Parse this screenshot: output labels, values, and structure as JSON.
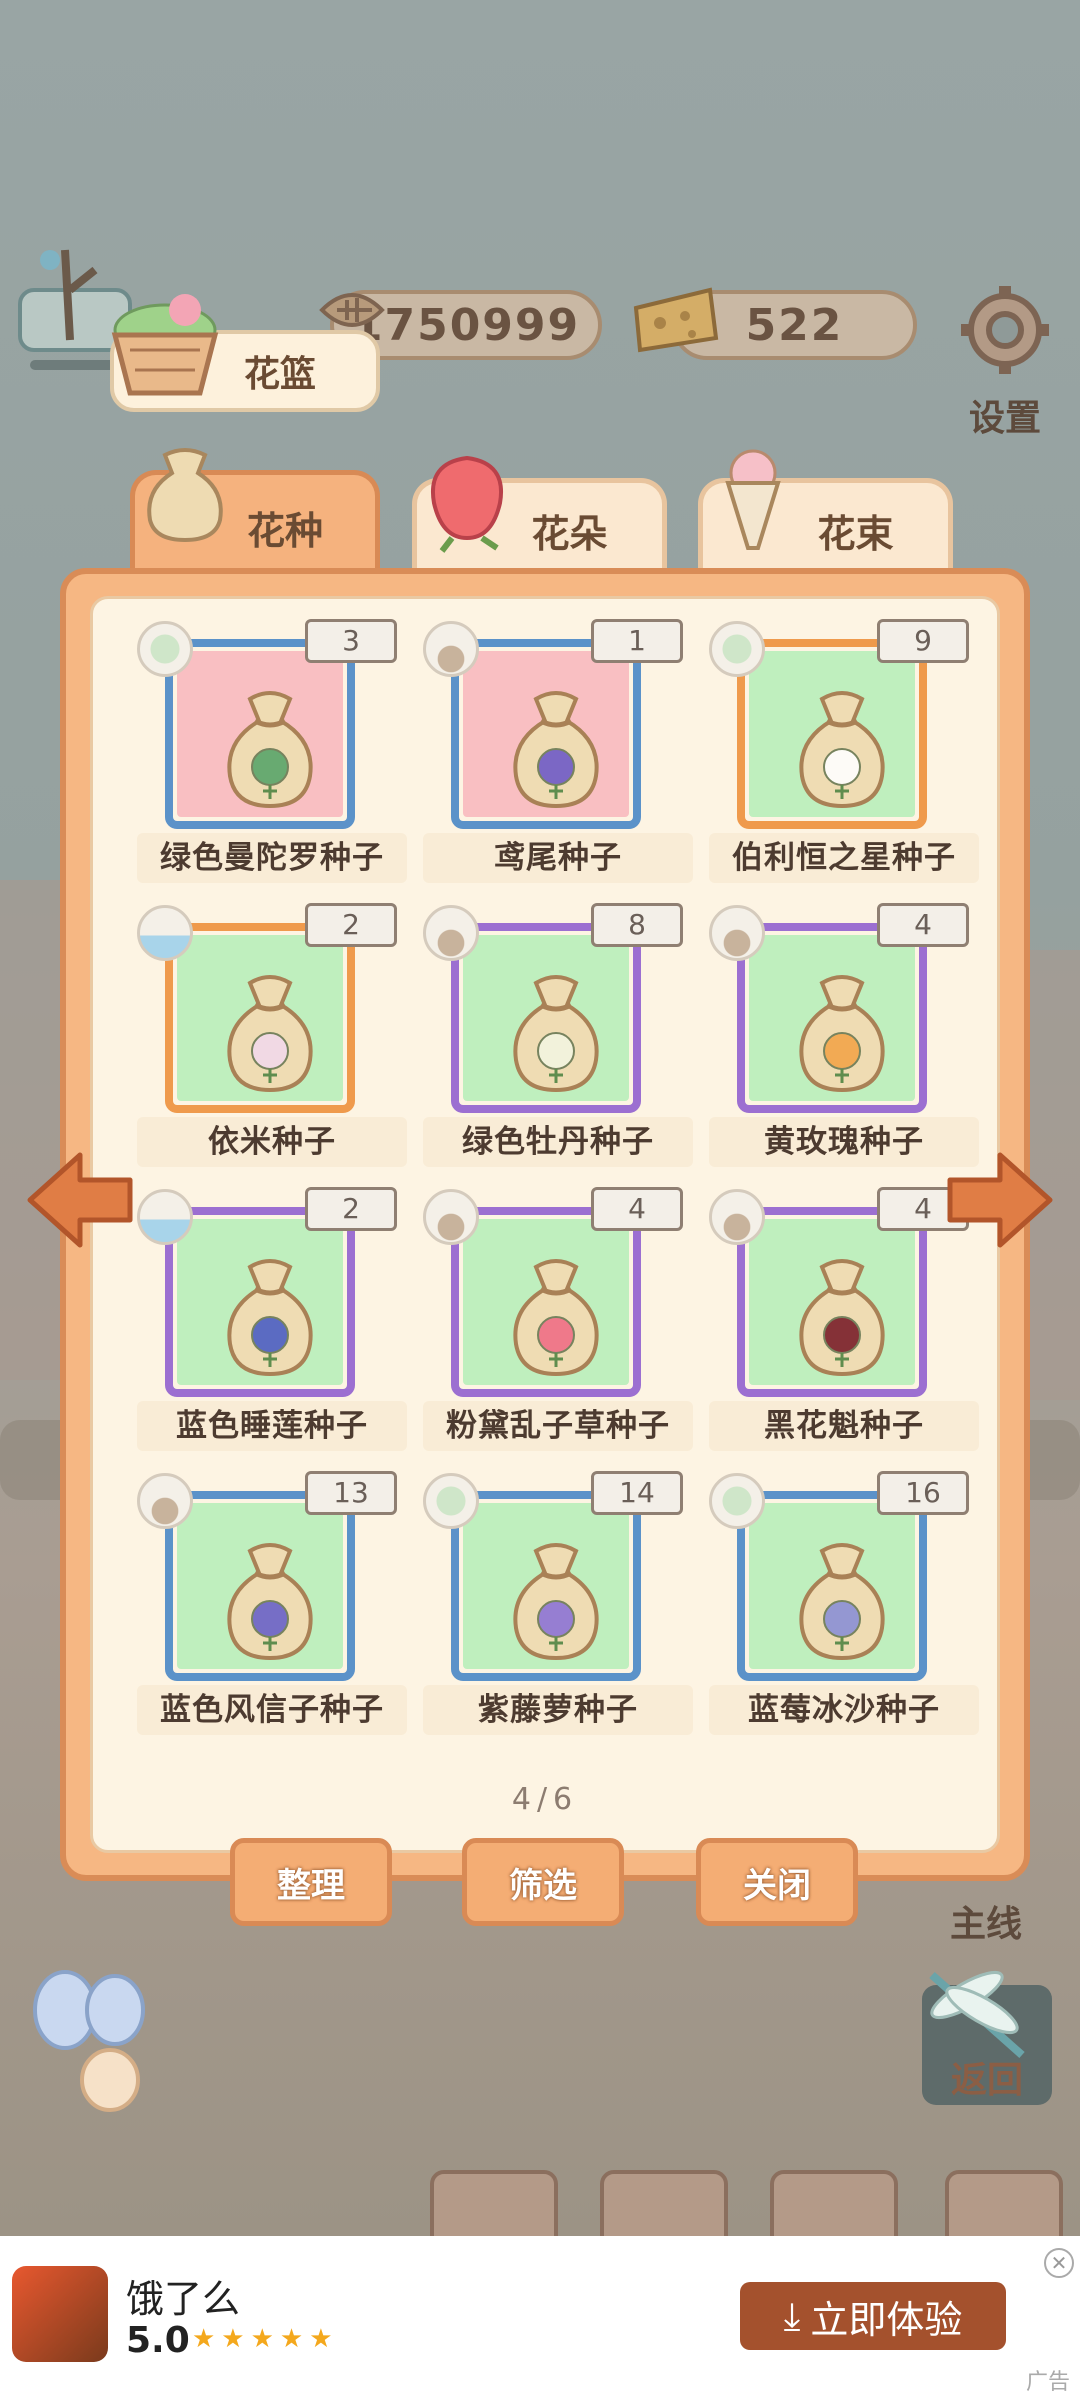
{
  "currencies": {
    "fish_bones": "1750999",
    "cheese": "522"
  },
  "side": {
    "settings_label": "设置",
    "mainline_label": "主线",
    "back_label": "返回"
  },
  "basket": {
    "label": "花篮"
  },
  "tabs": [
    {
      "label": "花种",
      "active": true
    },
    {
      "label": "花朵",
      "active": false
    },
    {
      "label": "花束",
      "active": false
    }
  ],
  "items": [
    {
      "name": "绿色曼陀罗种子",
      "count": "3",
      "frame": "blue",
      "bg": "pink",
      "type": "leaf",
      "flower": "#5aa56a"
    },
    {
      "name": "鸢尾种子",
      "count": "1",
      "frame": "blue",
      "bg": "pink",
      "type": "sand",
      "flower": "#6f5bc7"
    },
    {
      "name": "伯利恒之星种子",
      "count": "9",
      "frame": "orange",
      "bg": "green",
      "type": "leaf",
      "flower": "#ffffff"
    },
    {
      "name": "依米种子",
      "count": "2",
      "frame": "orange",
      "bg": "green",
      "type": "water",
      "flower": "#f2d9ea"
    },
    {
      "name": "绿色牡丹种子",
      "count": "8",
      "frame": "purple",
      "bg": "green",
      "type": "sand",
      "flower": "#f3f5e0"
    },
    {
      "name": "黄玫瑰种子",
      "count": "4",
      "frame": "purple",
      "bg": "green",
      "type": "sand",
      "flower": "#f3a54a"
    },
    {
      "name": "蓝色睡莲种子",
      "count": "2",
      "frame": "purple",
      "bg": "green",
      "type": "water",
      "flower": "#4b5fc4"
    },
    {
      "name": "粉黛乱子草种子",
      "count": "4",
      "frame": "purple",
      "bg": "green",
      "type": "sand",
      "flower": "#ef6f86"
    },
    {
      "name": "黑花魁种子",
      "count": "4",
      "frame": "purple",
      "bg": "green",
      "type": "sand",
      "flower": "#7a1f2a"
    },
    {
      "name": "蓝色风信子种子",
      "count": "13",
      "frame": "blue",
      "bg": "green",
      "type": "sand",
      "flower": "#6a63c9"
    },
    {
      "name": "紫藤萝种子",
      "count": "14",
      "frame": "blue",
      "bg": "green",
      "type": "leaf",
      "flower": "#8d74d6"
    },
    {
      "name": "蓝莓冰沙种子",
      "count": "16",
      "frame": "blue",
      "bg": "green",
      "type": "leaf",
      "flower": "#8b90d6"
    }
  ],
  "pager": "4/6",
  "buttons": {
    "sort": "整理",
    "filter": "筛选",
    "close": "关闭"
  },
  "ad": {
    "app_name": "饿了么",
    "rating": "5.0",
    "stars": "★★★★★",
    "cta": "立即体验",
    "cta_icon": "download-icon",
    "tag": "广告"
  }
}
